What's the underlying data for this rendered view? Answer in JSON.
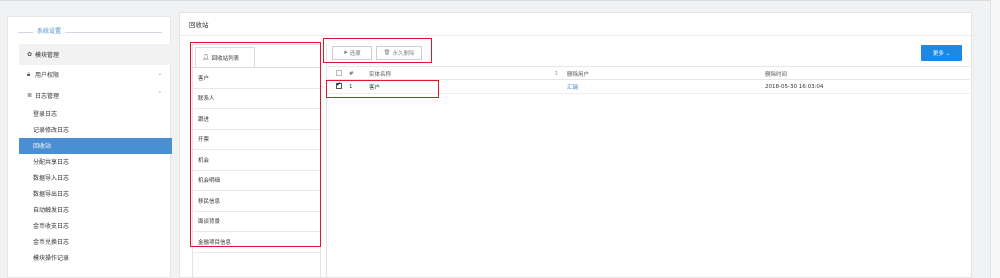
{
  "sidebar": {
    "title": "系统设置",
    "items": [
      {
        "label": "模块管理",
        "icon": "gear-icon"
      },
      {
        "label": "用户权限",
        "icon": "lock-icon",
        "chevron": "⌄"
      },
      {
        "label": "日志管理",
        "icon": "list-icon",
        "chevron": "⌃"
      }
    ],
    "subitems": [
      {
        "label": "登录日志"
      },
      {
        "label": "记录修改日志"
      },
      {
        "label": "回收站",
        "active": true
      },
      {
        "label": "分配共享日志"
      },
      {
        "label": "数据导入日志"
      },
      {
        "label": "数据导出日志"
      },
      {
        "label": "自动触发日志"
      },
      {
        "label": "金币收支日志"
      },
      {
        "label": "金币兑换日志"
      },
      {
        "label": "模块操作记录"
      }
    ]
  },
  "main": {
    "title": "回收站",
    "list_tab": {
      "label": "回收站列表",
      "icon": "user-icon"
    },
    "list_items": [
      "客户",
      "联系人",
      "跟进",
      "开票",
      "机会",
      "机会明细",
      "移民信息",
      "面谈背景",
      "金融项目信息"
    ],
    "toolbar": {
      "restore_label": "还原",
      "delete_label": "永久删除",
      "more_label": "更多 ⌄"
    },
    "table": {
      "headers": {
        "num": "#",
        "name": "实体名称",
        "sort": "↕",
        "user": "删除用户",
        "time": "删除时间"
      },
      "rows": [
        {
          "checked": true,
          "num": "1",
          "name": "客户",
          "user": "汇瑞",
          "time": "2018-05-30 16:03:04"
        }
      ]
    }
  },
  "colors": {
    "accent": "#1e88e5",
    "active_nav": "#4a8fd3",
    "highlight": "#e0162b",
    "link": "#3a7bd5"
  }
}
